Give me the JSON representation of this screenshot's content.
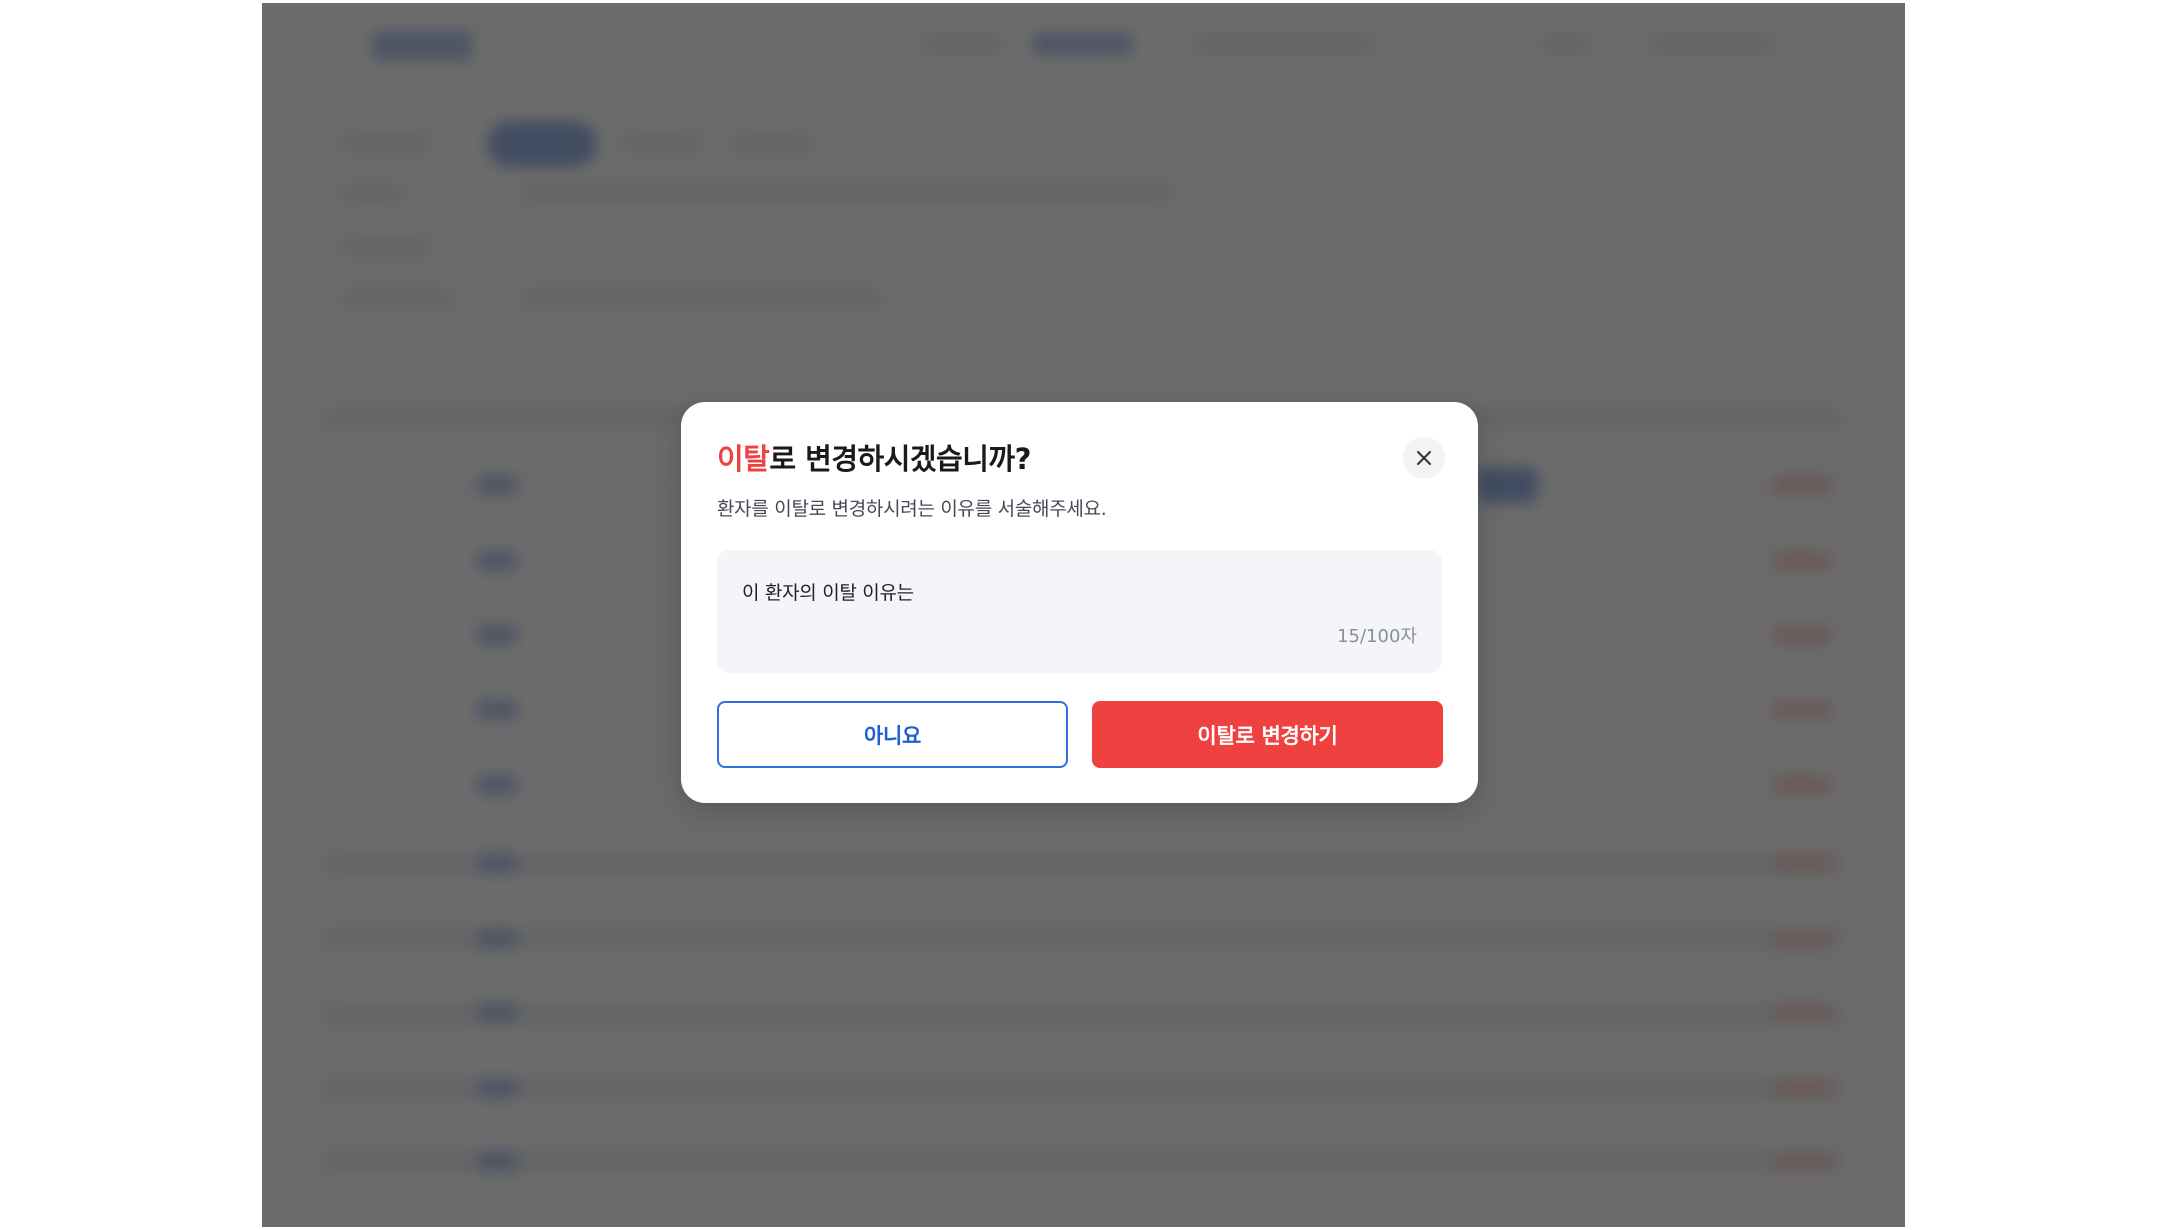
{
  "modal": {
    "title_accent": "이탈",
    "title_rest": "로 변경하시겠습니까?",
    "description": "환자를 이탈로 변경하시려는 이유를 서술해주세요.",
    "reason_value": "이 환자의 이탈 이유는",
    "char_count": "15/100자",
    "cancel_label": "아니요",
    "confirm_label": "이탈로 변경하기"
  },
  "colors": {
    "accent_red": "#f04141",
    "primary_blue": "#1f5fd6",
    "overlay": "#4b4b4b"
  },
  "icons": {
    "close": "close-icon"
  }
}
